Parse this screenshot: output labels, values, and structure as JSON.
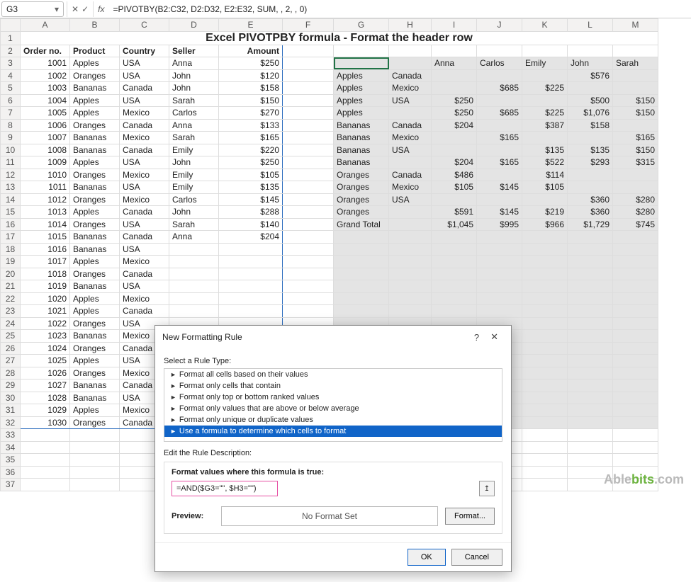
{
  "name_box": "G3",
  "fx_cancel": "✕",
  "fx_accept": "✓",
  "fx_label": "fx",
  "formula": "=PIVOTBY(B2:C32, D2:D32, E2:E32, SUM, , 2, , 0)",
  "cols": [
    "A",
    "B",
    "C",
    "D",
    "E",
    "F",
    "G",
    "H",
    "I",
    "J",
    "K",
    "L",
    "M"
  ],
  "title": "Excel PIVOTPBY formula - Format the header row",
  "data_headers": [
    "Order no.",
    "Product",
    "Country",
    "Seller",
    "Amount"
  ],
  "data_rows": [
    [
      "1001",
      "Apples",
      "USA",
      "Anna",
      "$250"
    ],
    [
      "1002",
      "Oranges",
      "USA",
      "John",
      "$120"
    ],
    [
      "1003",
      "Bananas",
      "Canada",
      "John",
      "$158"
    ],
    [
      "1004",
      "Apples",
      "USA",
      "Sarah",
      "$150"
    ],
    [
      "1005",
      "Apples",
      "Mexico",
      "Carlos",
      "$270"
    ],
    [
      "1006",
      "Oranges",
      "Canada",
      "Anna",
      "$133"
    ],
    [
      "1007",
      "Bananas",
      "Mexico",
      "Sarah",
      "$165"
    ],
    [
      "1008",
      "Bananas",
      "Canada",
      "Emily",
      "$220"
    ],
    [
      "1009",
      "Apples",
      "USA",
      "John",
      "$250"
    ],
    [
      "1010",
      "Oranges",
      "Mexico",
      "Emily",
      "$105"
    ],
    [
      "1011",
      "Bananas",
      "USA",
      "Emily",
      "$135"
    ],
    [
      "1012",
      "Oranges",
      "Mexico",
      "Carlos",
      "$145"
    ],
    [
      "1013",
      "Apples",
      "Canada",
      "John",
      "$288"
    ],
    [
      "1014",
      "Oranges",
      "USA",
      "Sarah",
      "$140"
    ],
    [
      "1015",
      "Bananas",
      "Canada",
      "Anna",
      "$204"
    ],
    [
      "1016",
      "Bananas",
      "USA",
      "",
      ""
    ],
    [
      "1017",
      "Apples",
      "Mexico",
      "",
      ""
    ],
    [
      "1018",
      "Oranges",
      "Canada",
      "",
      ""
    ],
    [
      "1019",
      "Bananas",
      "USA",
      "",
      ""
    ],
    [
      "1020",
      "Apples",
      "Mexico",
      "",
      ""
    ],
    [
      "1021",
      "Apples",
      "Canada",
      "",
      ""
    ],
    [
      "1022",
      "Oranges",
      "USA",
      "",
      ""
    ],
    [
      "1023",
      "Bananas",
      "Mexico",
      "",
      ""
    ],
    [
      "1024",
      "Oranges",
      "Canada",
      "",
      ""
    ],
    [
      "1025",
      "Apples",
      "USA",
      "",
      ""
    ],
    [
      "1026",
      "Oranges",
      "Mexico",
      "",
      ""
    ],
    [
      "1027",
      "Bananas",
      "Canada",
      "",
      ""
    ],
    [
      "1028",
      "Bananas",
      "USA",
      "",
      ""
    ],
    [
      "1029",
      "Apples",
      "Mexico",
      "",
      ""
    ],
    [
      "1030",
      "Oranges",
      "Canada",
      "",
      ""
    ]
  ],
  "pivot_header": [
    "",
    "",
    "Anna",
    "Carlos",
    "Emily",
    "John",
    "Sarah"
  ],
  "pivot_rows": [
    [
      "Apples",
      "Canada",
      "",
      "",
      "",
      "$576",
      ""
    ],
    [
      "Apples",
      "Mexico",
      "",
      "$685",
      "$225",
      "",
      ""
    ],
    [
      "Apples",
      "USA",
      "$250",
      "",
      "",
      "$500",
      "$150"
    ],
    [
      "Apples",
      "",
      "$250",
      "$685",
      "$225",
      "$1,076",
      "$150"
    ],
    [
      "Bananas",
      "Canada",
      "$204",
      "",
      "$387",
      "$158",
      ""
    ],
    [
      "Bananas",
      "Mexico",
      "",
      "$165",
      "",
      "",
      "$165"
    ],
    [
      "Bananas",
      "USA",
      "",
      "",
      "$135",
      "$135",
      "$150"
    ],
    [
      "Bananas",
      "",
      "$204",
      "$165",
      "$522",
      "$293",
      "$315"
    ],
    [
      "Oranges",
      "Canada",
      "$486",
      "",
      "$114",
      "",
      ""
    ],
    [
      "Oranges",
      "Mexico",
      "$105",
      "$145",
      "$105",
      "",
      ""
    ],
    [
      "Oranges",
      "USA",
      "",
      "",
      "",
      "$360",
      "$280"
    ],
    [
      "Oranges",
      "",
      "$591",
      "$145",
      "$219",
      "$360",
      "$280"
    ],
    [
      "Grand Total",
      "",
      "$1,045",
      "$995",
      "$966",
      "$1,729",
      "$745"
    ]
  ],
  "dialog": {
    "title": "New Formatting Rule",
    "help": "?",
    "close": "✕",
    "select_label": "Select a Rule Type:",
    "rules": [
      "Format all cells based on their values",
      "Format only cells that contain",
      "Format only top or bottom ranked values",
      "Format only values that are above or below average",
      "Format only unique or duplicate values",
      "Use a formula to determine which cells to format"
    ],
    "edit_label": "Edit the Rule Description:",
    "formula_label": "Format values where this formula is true:",
    "formula_value": "=AND($G3=\"\", $H3=\"\")",
    "ref_icon": "↥",
    "preview_label": "Preview:",
    "preview_text": "No Format Set",
    "format_btn": "Format...",
    "ok": "OK",
    "cancel": "Cancel"
  },
  "watermark_a": "Able",
  "watermark_b": "bits",
  "watermark_c": ".com"
}
